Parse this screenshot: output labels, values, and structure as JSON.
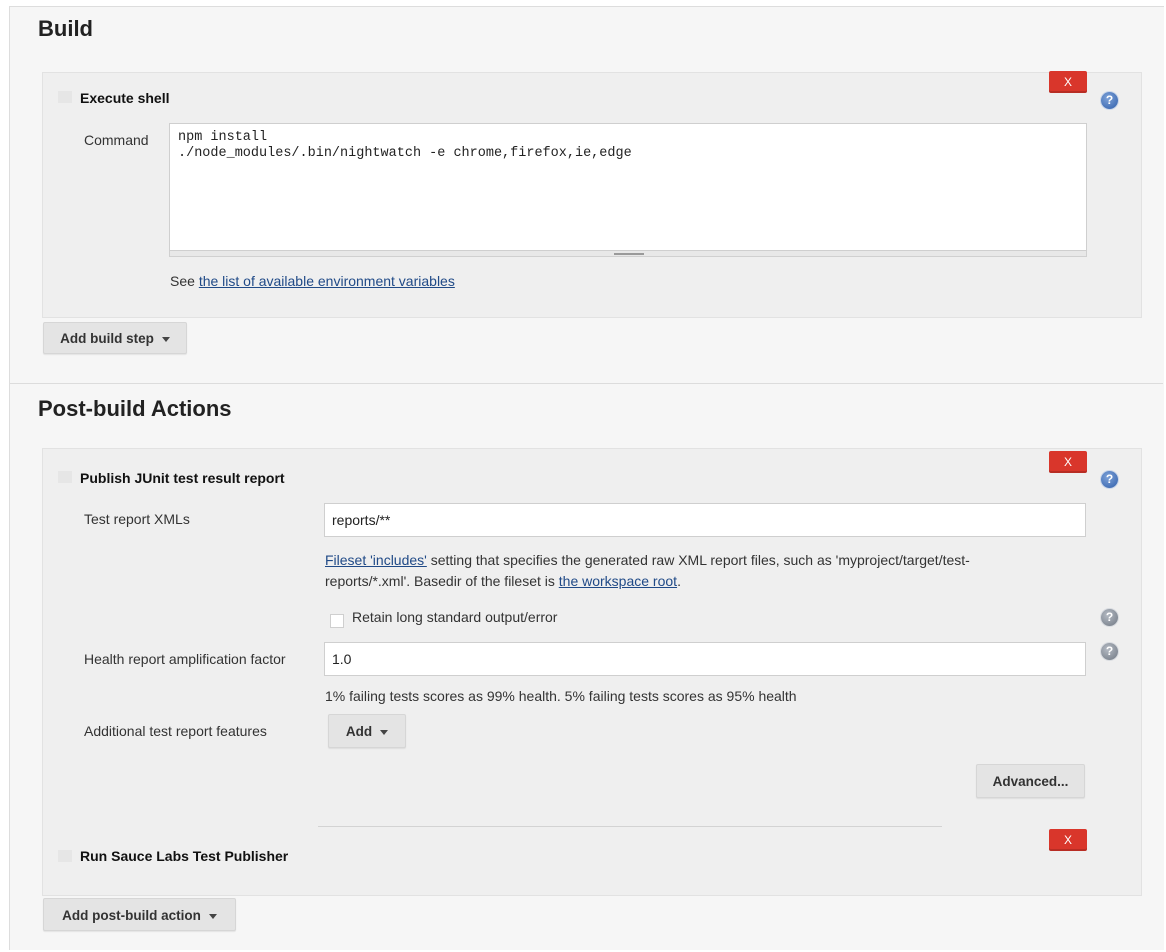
{
  "build": {
    "title": "Build",
    "step": {
      "title": "Execute shell",
      "delete_label": "X",
      "help_glyph": "?",
      "command_label": "Command",
      "command_value": "npm install\n./node_modules/.bin/nightwatch -e chrome,firefox,ie,edge",
      "env_prefix": "See ",
      "env_link": "the list of available environment variables"
    },
    "add_button": "Add build step"
  },
  "post_build": {
    "title": "Post-build Actions",
    "junit": {
      "title": "Publish JUnit test result report",
      "delete_label": "X",
      "help_glyph": "?",
      "xml_label": "Test report XMLs",
      "xml_value": "reports/**",
      "fileset_link": "Fileset 'includes'",
      "fileset_desc_1": " setting that specifies the generated raw XML report files, such as 'myproject/target/test-",
      "fileset_desc_2": "reports/*.xml'. Basedir of the fileset is ",
      "workspace_link": "the workspace root",
      "fileset_desc_end": ".",
      "retain_label": "Retain long standard output/error",
      "health_label": "Health report amplification factor",
      "health_value": "1.0",
      "health_desc": "1% failing tests scores as 99% health. 5% failing tests scores as 95% health",
      "features_label": "Additional test report features",
      "add_label": "Add",
      "advanced_label": "Advanced..."
    },
    "sauce": {
      "title": "Run Sauce Labs Test Publisher",
      "delete_label": "X"
    },
    "add_button": "Add post-build action"
  },
  "colors": {
    "delete": "#d9362b",
    "help": "#2f5fab",
    "link": "#204a87"
  }
}
